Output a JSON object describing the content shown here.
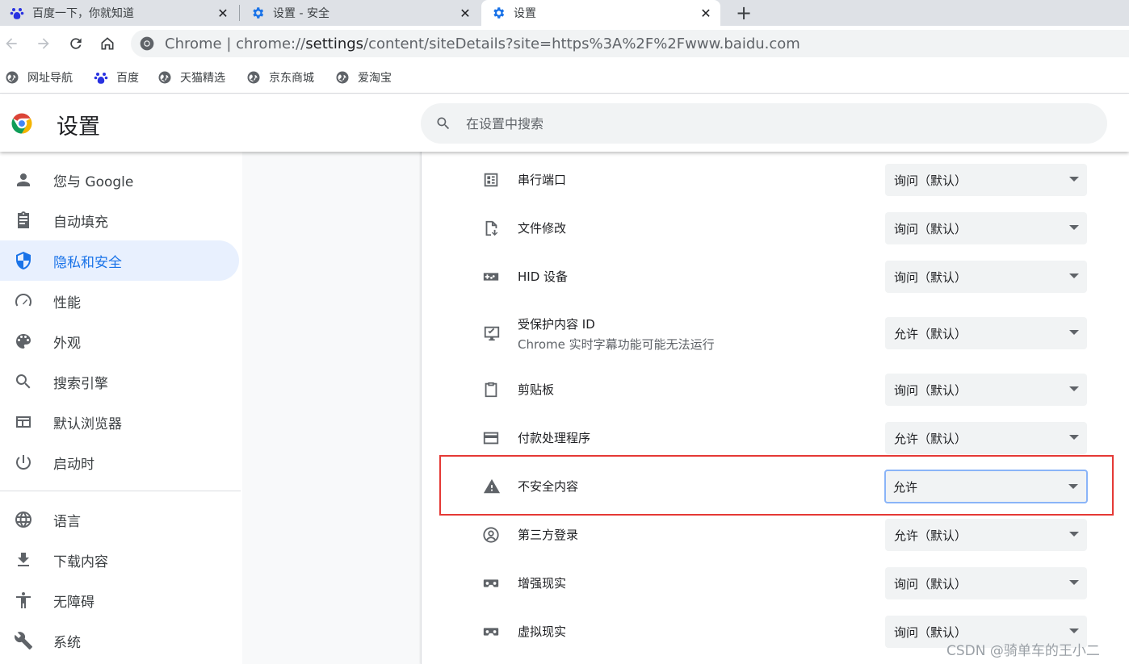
{
  "tabs": [
    {
      "title": "百度一下，你就知道",
      "icon": "baidu-paw-icon",
      "active": false
    },
    {
      "title": "设置 - 安全",
      "icon": "gear-icon",
      "active": false
    },
    {
      "title": "设置",
      "icon": "gear-icon",
      "active": true
    }
  ],
  "new_tab_label": "+",
  "close_glyph": "✕",
  "omnibox": {
    "origin_label": "Chrome",
    "separator": " | ",
    "url_scheme": "chrome://",
    "url_host": "settings",
    "url_path": "/content/siteDetails?site=https%3A%2F%2Fwww.baidu.com"
  },
  "bookmarks": [
    {
      "label": "网址导航",
      "icon": "globe-icon"
    },
    {
      "label": "百度",
      "icon": "baidu-paw-icon"
    },
    {
      "label": "天猫精选",
      "icon": "globe-icon"
    },
    {
      "label": "京东商城",
      "icon": "globe-icon"
    },
    {
      "label": "爱淘宝",
      "icon": "globe-icon"
    }
  ],
  "settings": {
    "title": "设置",
    "search_placeholder": "在设置中搜索"
  },
  "sidebar": {
    "items": [
      {
        "label": "您与 Google",
        "icon": "person-icon"
      },
      {
        "label": "自动填充",
        "icon": "clipboard-icon"
      },
      {
        "label": "隐私和安全",
        "icon": "shield-icon",
        "selected": true
      },
      {
        "label": "性能",
        "icon": "speedometer-icon"
      },
      {
        "label": "外观",
        "icon": "palette-icon"
      },
      {
        "label": "搜索引擎",
        "icon": "search-icon"
      },
      {
        "label": "默认浏览器",
        "icon": "browser-window-icon"
      },
      {
        "label": "启动时",
        "icon": "power-icon"
      },
      {
        "label": "语言",
        "icon": "globe-icon"
      },
      {
        "label": "下载内容",
        "icon": "download-icon"
      },
      {
        "label": "无障碍",
        "icon": "accessibility-icon"
      },
      {
        "label": "系统",
        "icon": "wrench-icon"
      }
    ]
  },
  "permissions": [
    {
      "label": "串行端口",
      "value": "询问（默认）",
      "icon": "serial-port-icon"
    },
    {
      "label": "文件修改",
      "value": "询问（默认）",
      "icon": "file-edit-icon"
    },
    {
      "label": "HID 设备",
      "value": "询问（默认）",
      "icon": "gamepad-icon"
    },
    {
      "label": "受保护内容 ID",
      "sublabel": "Chrome 实时字幕功能可能无法运行",
      "value": "允许（默认）",
      "icon": "protected-content-icon"
    },
    {
      "label": "剪贴板",
      "value": "询问（默认）",
      "icon": "clipboard-icon"
    },
    {
      "label": "付款处理程序",
      "value": "允许（默认）",
      "icon": "credit-card-icon"
    },
    {
      "label": "不安全内容",
      "value": "允许",
      "icon": "warning-icon",
      "highlighted": true
    },
    {
      "label": "第三方登录",
      "value": "允许（默认）",
      "icon": "account-circle-icon"
    },
    {
      "label": "增强现实",
      "value": "询问（默认）",
      "icon": "vr-headset-icon"
    },
    {
      "label": "虚拟现实",
      "value": "询问（默认）",
      "icon": "vr-headset-icon"
    }
  ],
  "watermark": "CSDN @骑单车的王小二",
  "colors": {
    "accent": "#1a73e8",
    "selected_bg": "#e8f0fe",
    "highlight_border": "#e53935",
    "focus_ring": "#8ab4f8"
  }
}
